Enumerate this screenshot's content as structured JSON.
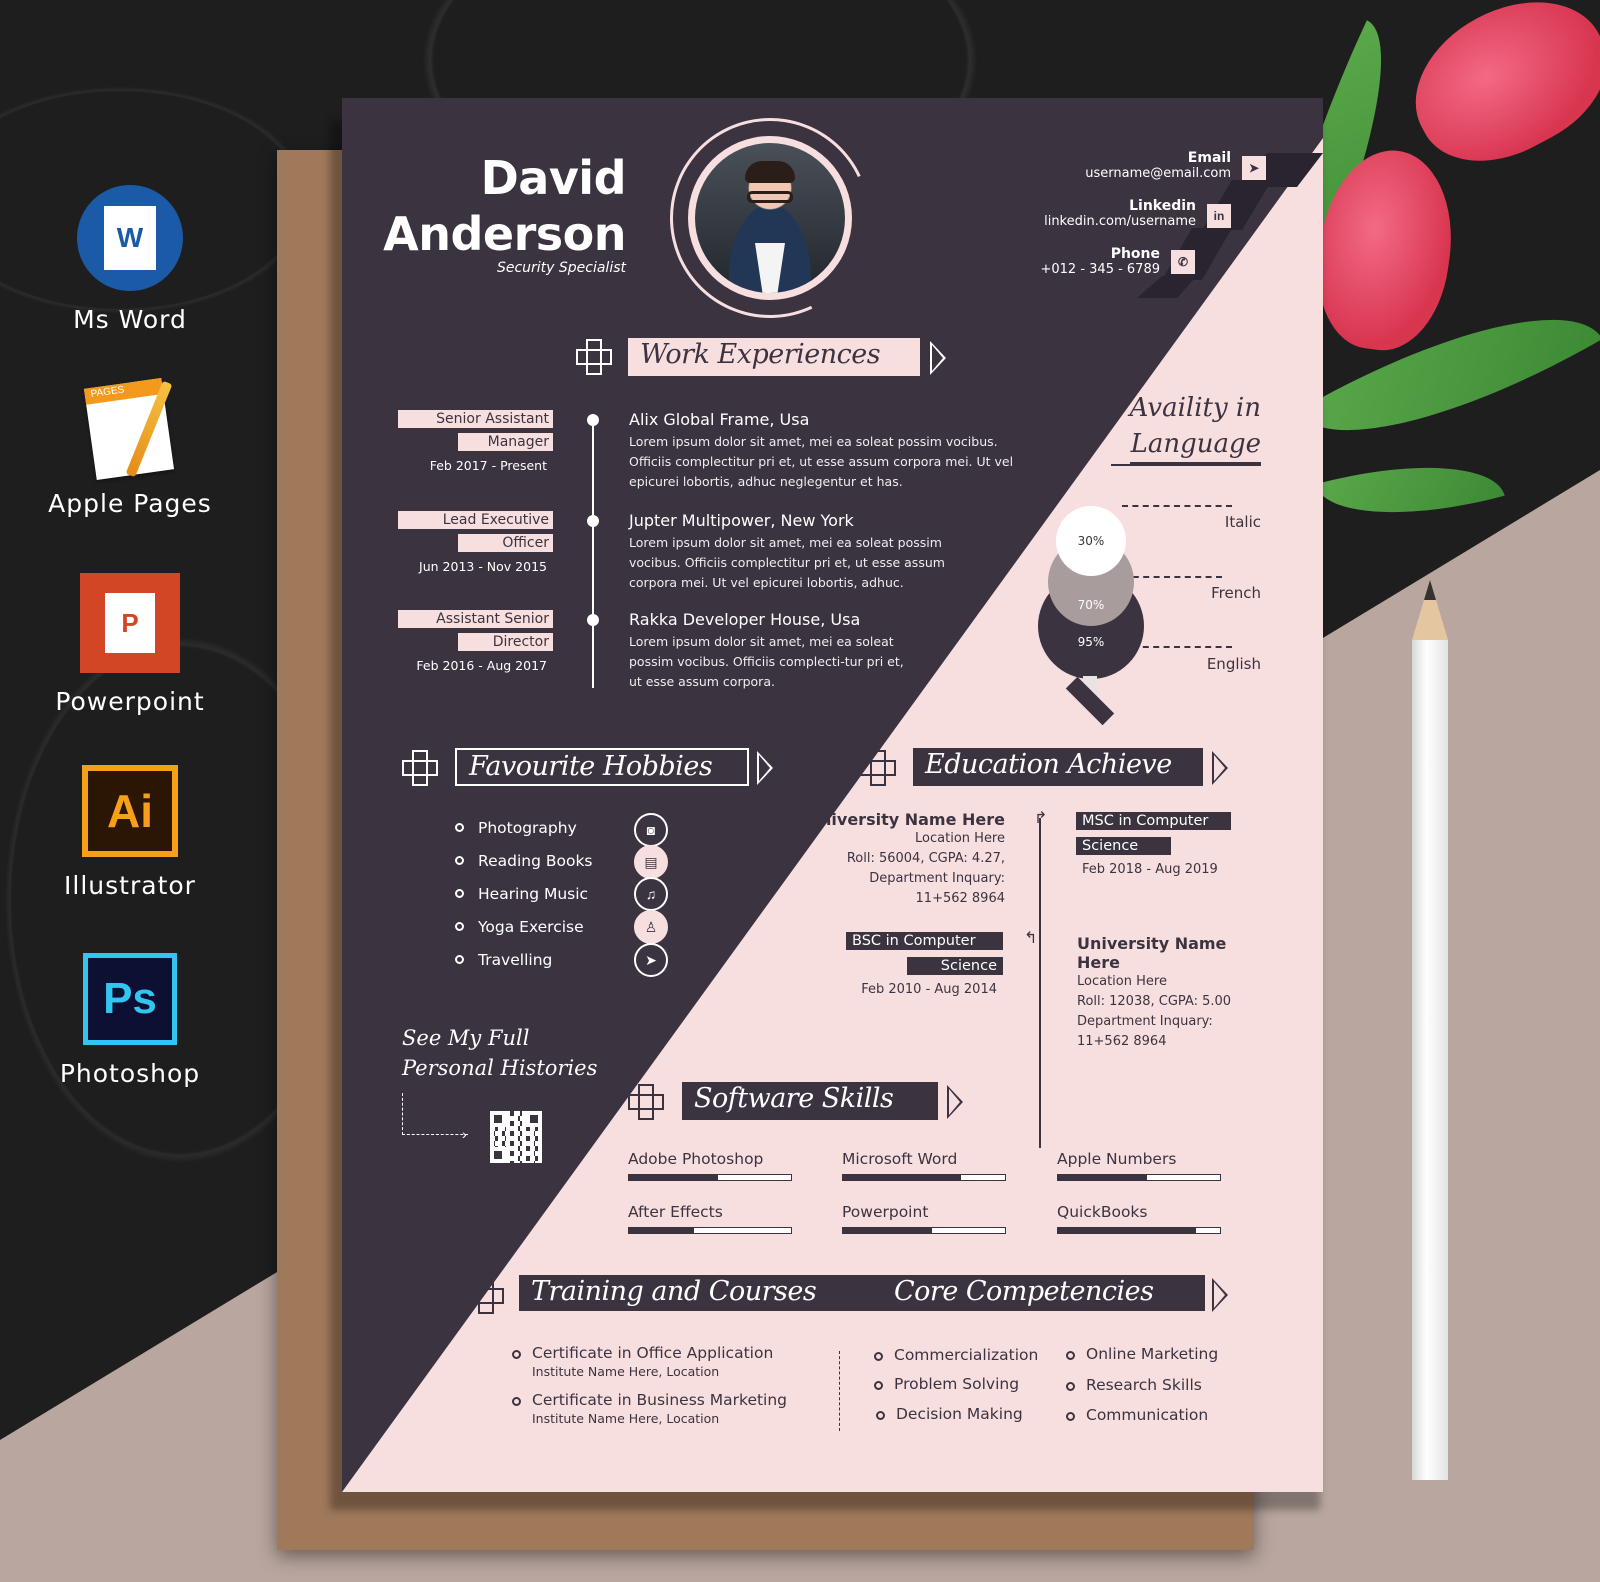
{
  "formats": [
    {
      "label": "Ms Word",
      "icon": "ms-word-icon",
      "glyph": "W"
    },
    {
      "label": "Apple Pages",
      "icon": "apple-pages-icon",
      "glyph": "PAGES"
    },
    {
      "label": "Powerpoint",
      "icon": "powerpoint-icon",
      "glyph": "P"
    },
    {
      "label": "Illustrator",
      "icon": "illustrator-icon",
      "glyph": "Ai"
    },
    {
      "label": "Photoshop",
      "icon": "photoshop-icon",
      "glyph": "Ps"
    }
  ],
  "header": {
    "first_name": "David",
    "last_name": "Anderson",
    "role": "Security Specialist"
  },
  "contacts": [
    {
      "title": "Email",
      "value": "username@email.com",
      "icon": "send-icon",
      "glyph": "➤"
    },
    {
      "title": "Linkedin",
      "value": "linkedin.com/username",
      "icon": "linkedin-icon",
      "glyph": "in"
    },
    {
      "title": "Phone",
      "value": "+012 - 345 - 6789",
      "icon": "phone-icon",
      "glyph": "✆"
    }
  ],
  "work": {
    "title": "Work Experiences",
    "jobs": [
      {
        "role_line1": "Senior Assistant",
        "role_line2": "Manager",
        "dates": "Feb 2017 - Present",
        "company": "Alix Global Frame, Usa",
        "description": "Lorem ipsum dolor sit amet, mei ea soleat possim vocibus. Officiis complectitur pri et, ut esse assum corpora mei. Ut vel epicurei lobortis, adhuc neglegentur et has."
      },
      {
        "role_line1": "Lead Executive",
        "role_line2": "Officer",
        "dates": "Jun 2013 - Nov 2015",
        "company": "Jupter Multipower, New York",
        "description": "Lorem ipsum dolor sit amet, mei ea soleat possim vocibus. Officiis complectitur pri et, ut esse assum corpora mei. Ut vel epicurei lobortis, adhuc."
      },
      {
        "role_line1": "Assistant Senior",
        "role_line2": "Director",
        "dates": "Feb 2016 - Aug 2017",
        "company": "Rakka Developer House, Usa",
        "description": "Lorem ipsum dolor sit amet, mei ea soleat possim vocibus. Officiis complecti-tur pri et, ut esse assum corpora."
      }
    ]
  },
  "language": {
    "title_line1": "Availity in",
    "title_line2": "Language",
    "items": [
      {
        "name": "Italic",
        "percent": 30,
        "label": "30%"
      },
      {
        "name": "French",
        "percent": 70,
        "label": "70%"
      },
      {
        "name": "English",
        "percent": 95,
        "label": "95%"
      }
    ]
  },
  "hobbies": {
    "title": "Favourite Hobbies",
    "items": [
      {
        "label": "Photography",
        "icon": "camera-icon",
        "glyph": "📷"
      },
      {
        "label": "Reading Books",
        "icon": "book-icon",
        "glyph": "▤"
      },
      {
        "label": "Hearing Music",
        "icon": "music-note-icon",
        "glyph": "♫"
      },
      {
        "label": "Yoga Exercise",
        "icon": "yoga-icon",
        "glyph": "☥"
      },
      {
        "label": "Travelling",
        "icon": "paper-plane-icon",
        "glyph": "➤"
      }
    ]
  },
  "education": {
    "title": "Education Achieve",
    "left": {
      "university": "University Name Here",
      "location": "Location Here",
      "roll": "Roll: 56004, CGPA: 4.27,",
      "dept": "Department Inquary:",
      "phone": "11+562 8964"
    },
    "msc": {
      "line1": "MSC in Computer",
      "line2": "Science",
      "dates": "Feb 2018 - Aug 2019"
    },
    "bsc": {
      "line1": "BSC in Computer",
      "line2": "Science",
      "dates": "Feb 2010 - Aug 2014"
    },
    "right": {
      "university_line1": "University Name",
      "university_line2": "Here",
      "location": "Location Here",
      "roll": "Roll: 12038, CGPA: 5.00",
      "dept": "Department Inquary:",
      "phone": "11+562 8964"
    }
  },
  "histories": {
    "line1": "See My Full",
    "line2": "Personal Histories"
  },
  "software": {
    "title": "Software Skills",
    "skills": [
      {
        "name": "Adobe Photoshop",
        "level": 0.55
      },
      {
        "name": "Microsoft Word",
        "level": 0.73
      },
      {
        "name": "Apple Numbers",
        "level": 0.55
      },
      {
        "name": "After Effects",
        "level": 0.4
      },
      {
        "name": "Powerpoint",
        "level": 0.55
      },
      {
        "name": "QuickBooks",
        "level": 0.85
      }
    ]
  },
  "training": {
    "title": "Training and Courses",
    "courses": [
      {
        "title": "Certificate in Office Application",
        "institute": "Institute Name Here, Location"
      },
      {
        "title": "Certificate in Business Marketing",
        "institute": "Institute Name Here, Location"
      }
    ]
  },
  "competencies": {
    "title": "Core Competencies",
    "items": [
      "Commercialization",
      "Problem Solving",
      "Decision Making",
      "Online Marketing",
      "Research Skills",
      "Communication"
    ]
  },
  "colors": {
    "dark": "#3c3341",
    "pink": "#f8dfdf"
  }
}
